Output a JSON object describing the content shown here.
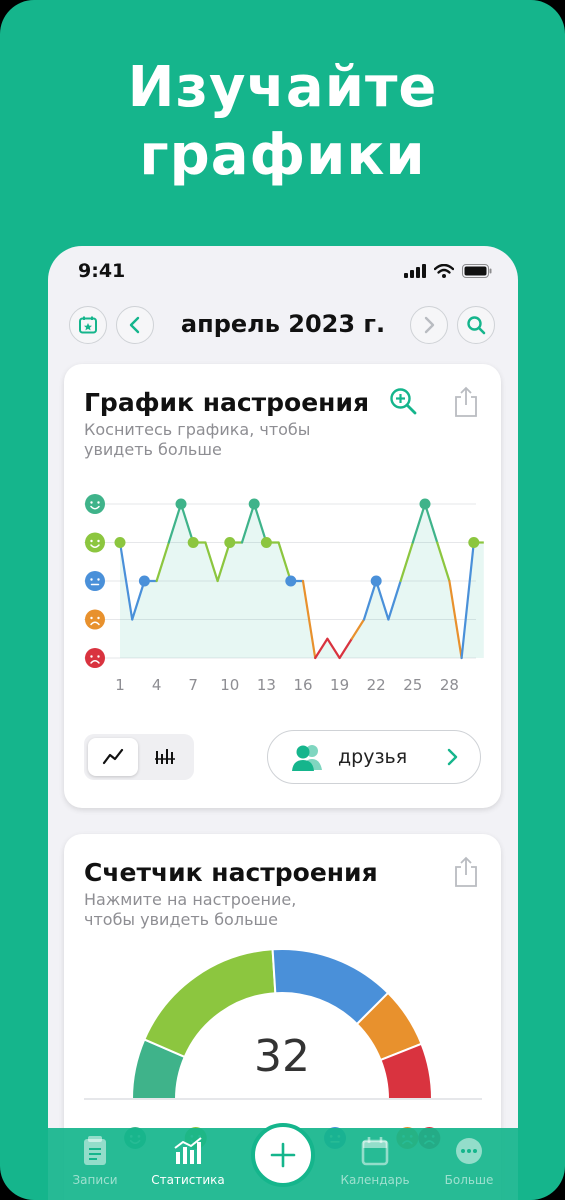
{
  "headline": {
    "line1": "Изучайте",
    "line2": "графики"
  },
  "status": {
    "time": "9:41"
  },
  "navbar": {
    "title": "апрель 2023 г."
  },
  "mood_chart": {
    "title": "График настроения",
    "subtitle": "Коснитесь графика, чтобы увидеть больше",
    "friends_label": "друзья"
  },
  "mood_counter": {
    "title": "Счетчик настроения",
    "subtitle": "Нажмите на настроение, чтобы увидеть больше",
    "count": "32"
  },
  "tabs": [
    {
      "label": "Записи",
      "icon": "notes-icon"
    },
    {
      "label": "Статистика",
      "icon": "stats-icon"
    },
    {
      "label": "",
      "icon": "plus-icon"
    },
    {
      "label": "Календарь",
      "icon": "calendar-icon"
    },
    {
      "label": "Больше",
      "icon": "more-icon"
    }
  ],
  "colors": {
    "brand": "#15b58c",
    "mood_rad": "#3fb38a",
    "mood_good": "#8cc63f",
    "mood_meh": "#4a90d9",
    "mood_bad": "#e8912d",
    "mood_awful": "#d9333f"
  },
  "chart_data": [
    {
      "type": "line",
      "x": [
        1,
        2,
        3,
        4,
        5,
        6,
        7,
        8,
        9,
        10,
        11,
        12,
        13,
        14,
        15,
        16,
        17,
        18,
        19,
        20,
        21,
        22,
        23,
        24,
        25,
        26,
        27,
        28,
        29,
        30
      ],
      "values": [
        4,
        2,
        3,
        3,
        4,
        5,
        4,
        4,
        3,
        4,
        4,
        5,
        4,
        4,
        3,
        3,
        1,
        1.5,
        1,
        1.5,
        2,
        3,
        2,
        3,
        4,
        5,
        4,
        3,
        1,
        4
      ],
      "x_ticks": [
        "1",
        "4",
        "7",
        "10",
        "13",
        "16",
        "19",
        "22",
        "25",
        "28"
      ],
      "y_levels": [
        1,
        2,
        3,
        4,
        5
      ],
      "ylim": [
        1,
        5
      ],
      "grid": true
    },
    {
      "type": "pie",
      "style": "half-donut",
      "segments": [
        {
          "mood": "rad",
          "share": 0.13
        },
        {
          "mood": "good",
          "share": 0.35
        },
        {
          "mood": "meh",
          "share": 0.27
        },
        {
          "mood": "bad",
          "share": 0.13
        },
        {
          "mood": "awful",
          "share": 0.12
        }
      ]
    }
  ]
}
